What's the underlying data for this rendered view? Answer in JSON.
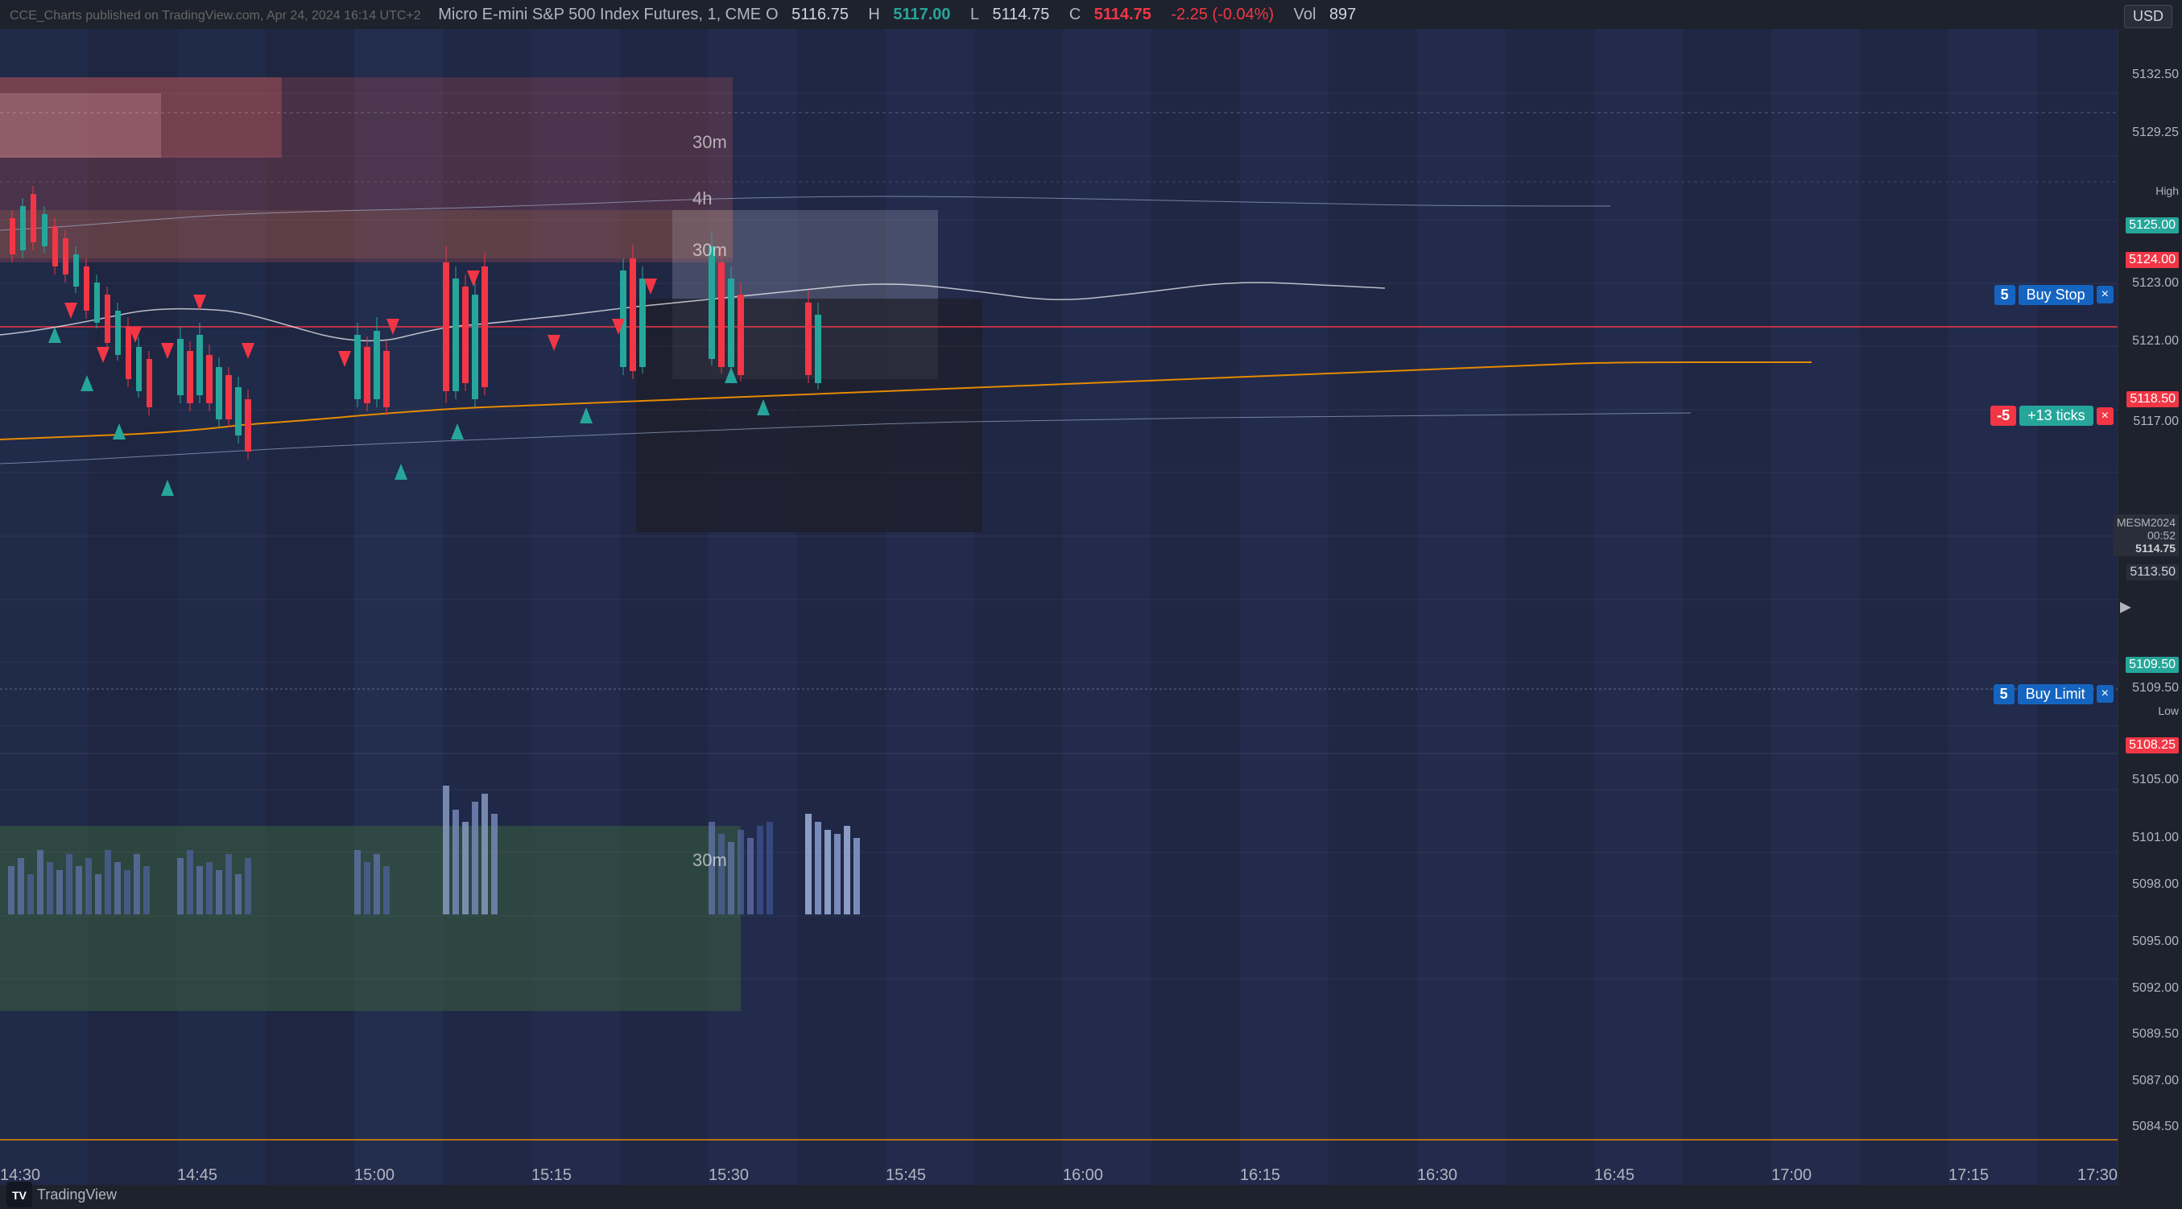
{
  "header": {
    "source": "CCE_Charts published on TradingView.com, Apr 24, 2024 16:14 UTC+2",
    "instrument": "Micro E-mini S&P 500 Index Futures, 1, CME",
    "open_label": "O",
    "open_value": "5116.75",
    "high_label": "H",
    "high_value": "5117.00",
    "low_label": "L",
    "low_value": "5114.75",
    "close_label": "C",
    "close_value": "5114.75",
    "change_value": "-2.25 (-0.04%)",
    "vol_label": "Vol",
    "vol_value": "897",
    "currency": "USD"
  },
  "price_levels": {
    "p5132_50": "5132.50",
    "p5129_25": "5129.25",
    "p5125_00": "5125.00",
    "p5124_00": "5124.00",
    "p5123_00": "5123.00",
    "p5121_00": "5121.00",
    "p5118_50": "5118.50",
    "p5117_00": "5117.00",
    "p5113_50": "5113.50",
    "p5109_50": "5109.50",
    "p5108_25": "5108.25",
    "p5105_00": "5105.00",
    "p5101_00": "5101.00",
    "p5098_00": "5098.00",
    "p5095_00": "5095.00",
    "p5092_00": "5092.00",
    "p5089_50": "5089.50",
    "p5087_00": "5087.00",
    "p5084_50": "5084.50"
  },
  "orders": {
    "buy_stop": {
      "qty": "5",
      "type": "Buy Stop",
      "price": "5123.00",
      "close": "×"
    },
    "position": {
      "qty": "-5",
      "ticks": "+13 ticks",
      "price": "5118.50",
      "close": "×"
    },
    "buy_limit": {
      "qty": "5",
      "type": "Buy Limit",
      "price": "5109.50",
      "close": "×"
    }
  },
  "mes_info": {
    "symbol": "MESM2024",
    "time": "00:52",
    "price": "5114.75",
    "last_price": "5113.50"
  },
  "zone_labels": {
    "z30m_top": "30m",
    "z4h": "4h",
    "z30m_mid": "30m",
    "z30m_bot": "30m"
  },
  "price_labels_axis": {
    "high_label": "High",
    "high_value": "5125.00",
    "low_label": "Low",
    "low_value": "5108.25"
  },
  "time_labels": [
    "14:30",
    "14:45",
    "15:00",
    "15:15",
    "15:30",
    "15:45",
    "16:00",
    "16:15",
    "16:30",
    "16:45",
    "17:00",
    "17:15",
    "17:30"
  ],
  "tradingview": {
    "logo_text": "TradingView"
  },
  "icons": {
    "tv_logo": "TV",
    "close_x": "×",
    "expand_arrow": "▶"
  }
}
